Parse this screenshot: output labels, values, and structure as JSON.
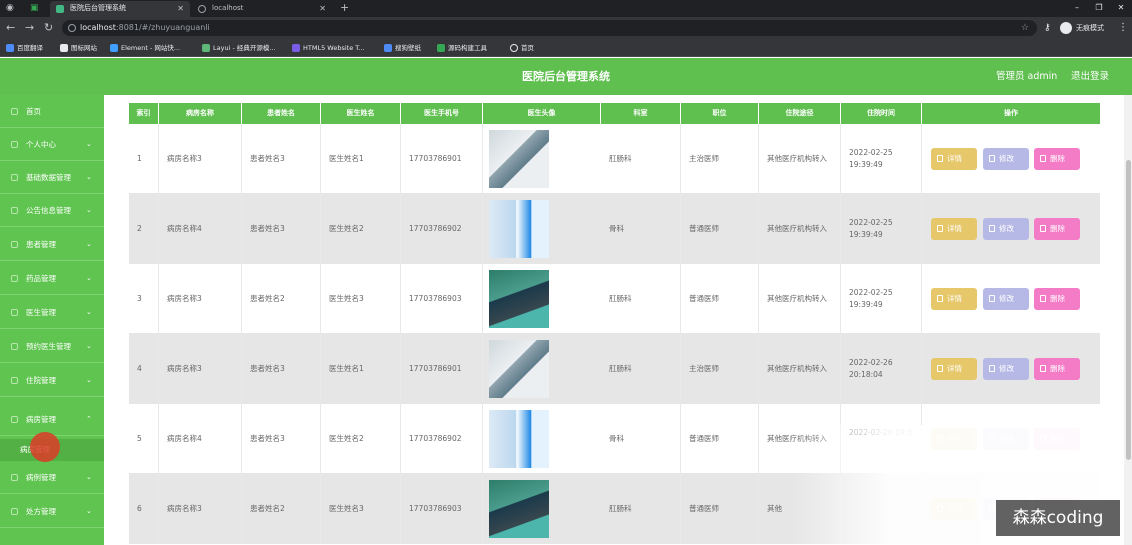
{
  "browser": {
    "tabs": [
      {
        "title": "医院后台管理系统",
        "active": true
      },
      {
        "title": "localhost",
        "active": false
      }
    ],
    "new_tab_label": "+",
    "url_host": "localhost",
    "url_path": ":8081/#/zhuyuanguanli",
    "profile_label": "无痕模式",
    "bookmarks": [
      "百度翻译",
      "图标网站",
      "Element - 网站快...",
      "Layui - 经典开源模...",
      "HTML5 Website T...",
      "搜狗壁纸",
      "源码构建工具",
      "首页"
    ]
  },
  "header": {
    "title": "医院后台管理系统",
    "user": "管理员 admin",
    "logout": "退出登录"
  },
  "sidebar": {
    "items": [
      {
        "label": "首页",
        "has_chevron": false
      },
      {
        "label": "个人中心",
        "has_chevron": true
      },
      {
        "label": "基础数据管理",
        "has_chevron": true
      },
      {
        "label": "公告信息管理",
        "has_chevron": true
      },
      {
        "label": "患者管理",
        "has_chevron": true
      },
      {
        "label": "药品管理",
        "has_chevron": true
      },
      {
        "label": "医生管理",
        "has_chevron": true
      },
      {
        "label": "预约医生管理",
        "has_chevron": true
      },
      {
        "label": "住院管理",
        "has_chevron": true
      },
      {
        "label": "病房管理",
        "has_chevron": true,
        "expanded": true
      },
      {
        "label": "病例管理",
        "has_chevron": true
      },
      {
        "label": "处方管理",
        "has_chevron": true
      }
    ],
    "active_sub": "病房管理"
  },
  "table": {
    "columns": [
      "索引",
      "病房名称",
      "患者姓名",
      "医生姓名",
      "医生手机号",
      "医生头像",
      "科室",
      "职位",
      "住院途径",
      "住院时间",
      "操作"
    ],
    "rows": [
      {
        "index": "1",
        "ward": "病房名称3",
        "patient": "患者姓名3",
        "doctor": "医生姓名1",
        "phone": "17703786901",
        "dept": "肛肠科",
        "title": "主治医师",
        "route": "其他医疗机构转入",
        "time": "2022-02-25 19:39:49"
      },
      {
        "index": "2",
        "ward": "病房名称4",
        "patient": "患者姓名3",
        "doctor": "医生姓名2",
        "phone": "17703786902",
        "dept": "骨科",
        "title": "普通医师",
        "route": "其他医疗机构转入",
        "time": "2022-02-25 19:39:49"
      },
      {
        "index": "3",
        "ward": "病房名称3",
        "patient": "患者姓名2",
        "doctor": "医生姓名3",
        "phone": "17703786903",
        "dept": "肛肠科",
        "title": "普通医师",
        "route": "其他医疗机构转入",
        "time": "2022-02-25 19:39:49"
      },
      {
        "index": "4",
        "ward": "病房名称3",
        "patient": "患者姓名3",
        "doctor": "医生姓名1",
        "phone": "17703786901",
        "dept": "肛肠科",
        "title": "主治医师",
        "route": "其他医疗机构转入",
        "time": "2022-02-26 20:18:04"
      },
      {
        "index": "5",
        "ward": "病房名称4",
        "patient": "患者姓名3",
        "doctor": "医生姓名2",
        "phone": "17703786902",
        "dept": "骨科",
        "title": "普通医师",
        "route": "其他医疗机构转入",
        "time": "2022-02-26 19:3"
      },
      {
        "index": "6",
        "ward": "病房名称3",
        "patient": "患者姓名2",
        "doctor": "医生姓名3",
        "phone": "17703786903",
        "dept": "肛肠科",
        "title": "普通医师",
        "route": "其他",
        "time": ""
      }
    ],
    "actions": {
      "detail": "详情",
      "edit": "修改",
      "delete": "删除"
    }
  },
  "watermark": "森森coding",
  "colors": {
    "brand_green": "#5fbf4f",
    "detail": "#e6c76a",
    "edit": "#b6b9e6",
    "delete": "#f47cc6"
  }
}
